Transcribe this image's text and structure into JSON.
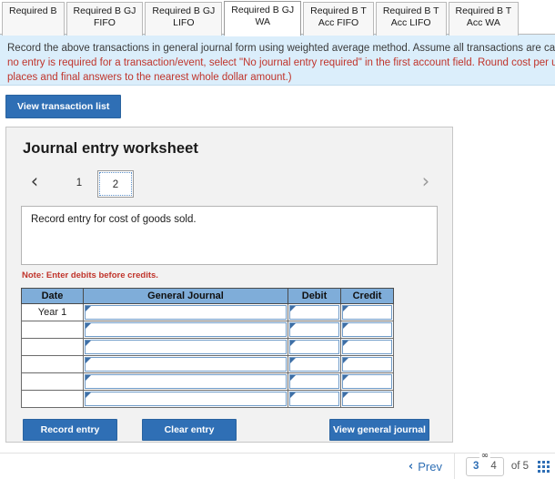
{
  "tabs": [
    {
      "line1": "Required B",
      "line2": "",
      "active": false
    },
    {
      "line1": "Required B GJ",
      "line2": "FIFO",
      "active": false
    },
    {
      "line1": "Required B GJ",
      "line2": "LIFO",
      "active": false
    },
    {
      "line1": "Required B GJ",
      "line2": "WA",
      "active": true
    },
    {
      "line1": "Required B T",
      "line2": "Acc FIFO",
      "active": false
    },
    {
      "line1": "Required B T",
      "line2": "Acc LIFO",
      "active": false
    },
    {
      "line1": "Required B T",
      "line2": "Acc WA",
      "active": false
    }
  ],
  "instructions": {
    "line1": "Record the above transactions in general journal form using weighted average method. Assume all transactions are cash t",
    "line2": "no entry is required for a transaction/event, select \"No journal entry required\" in the first account field. Round cost per un",
    "line3": "places and final answers to the nearest whole dollar amount.)"
  },
  "toolbar": {
    "view_transaction_list": "View transaction list"
  },
  "worksheet": {
    "title": "Journal entry worksheet",
    "pager": {
      "prev_icon": "‹",
      "next_icon": "›",
      "pages": [
        "1",
        "2"
      ],
      "selected": "2"
    },
    "description": "Record entry for cost of goods sold.",
    "note": "Note: Enter debits before credits.",
    "table": {
      "headers": [
        "Date",
        "General Journal",
        "Debit",
        "Credit"
      ],
      "rows": [
        {
          "date": "Year 1",
          "general_journal": "",
          "debit": "",
          "credit": ""
        },
        {
          "date": "",
          "general_journal": "",
          "debit": "",
          "credit": ""
        },
        {
          "date": "",
          "general_journal": "",
          "debit": "",
          "credit": ""
        },
        {
          "date": "",
          "general_journal": "",
          "debit": "",
          "credit": ""
        },
        {
          "date": "",
          "general_journal": "",
          "debit": "",
          "credit": ""
        },
        {
          "date": "",
          "general_journal": "",
          "debit": "",
          "credit": ""
        }
      ]
    },
    "actions": {
      "record_entry": "Record entry",
      "clear_entry": "Clear entry",
      "view_general_journal": "View general journal"
    }
  },
  "bottom_nav": {
    "prev_label": "Prev",
    "prev_icon": "‹",
    "link_icon": "∞",
    "current_page": "3",
    "next_page": "4",
    "of_label": "of 5"
  },
  "colors": {
    "accent_blue": "#2f6fb5",
    "header_blue": "#7fadd9",
    "instruction_bg": "#dbeefb",
    "instruction_text": "#c0342b",
    "panel_bg": "#f2f2f2"
  }
}
